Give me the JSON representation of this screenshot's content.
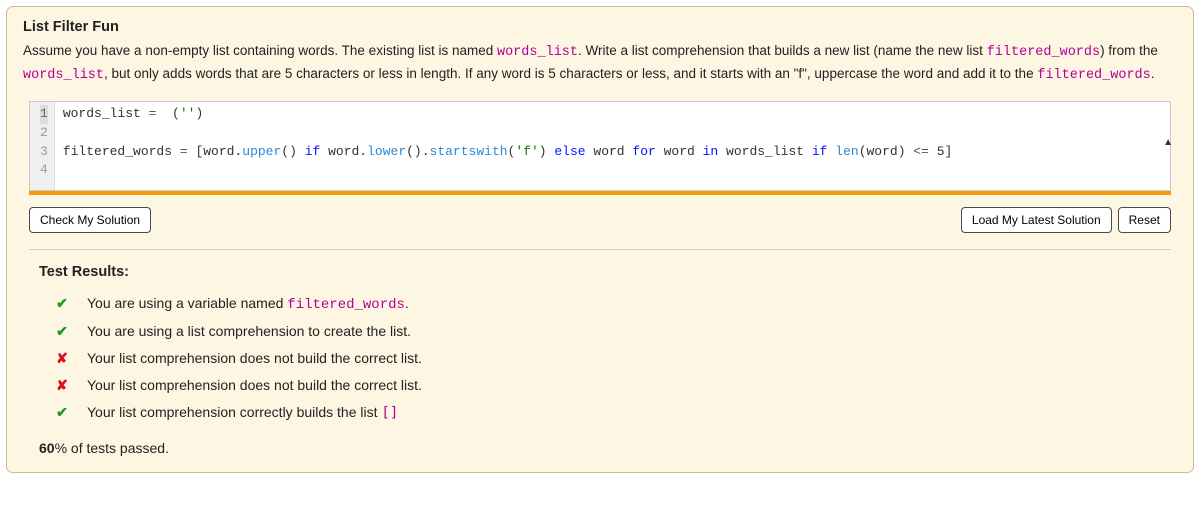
{
  "title": "List Filter Fun",
  "prompt": {
    "p1a": "Assume you have a non-empty list containing words. The existing list is named ",
    "words_list": "words_list",
    "p1b": ". Write a list comprehension that builds a new list (name the new list ",
    "filtered_words": "filtered_words",
    "p1c": ") from the ",
    "words_list2": "words_list",
    "p1d": ", but only adds words that are 5 characters or less in length. If any word is 5 characters or less, and it starts with an \"f\", uppercase the word and add it to the ",
    "filtered_words2": "filtered_words",
    "p1e": "."
  },
  "editor": {
    "lines": [
      "1",
      "2",
      "3",
      "4"
    ],
    "l1": {
      "a": "words_list ",
      "op": "=",
      "b": "  (",
      "str": "''",
      "c": ")"
    },
    "l3": {
      "a": "filtered_words ",
      "eq": "=",
      "b": " [word.",
      "upper": "upper",
      "c": "() ",
      "if1": "if",
      "d": " word.",
      "lower": "lower",
      "e": "().",
      "startswith": "startswith",
      "f": "(",
      "str": "'f'",
      "g": ") ",
      "else": "else",
      "h": " word ",
      "for": "for",
      "i": " word ",
      "in": "in",
      "j": " words_list ",
      "if2": "if",
      "k": " ",
      "len": "len",
      "l": "(word) ",
      "lte": "<=",
      "m": " ",
      "five": "5",
      "n": "]"
    }
  },
  "buttons": {
    "check": "Check My Solution",
    "load": "Load My Latest Solution",
    "reset": "Reset"
  },
  "results": {
    "title": "Test Results:",
    "items": [
      {
        "pass": true,
        "pre": "You are using a variable named ",
        "code": "filtered_words",
        "post": "."
      },
      {
        "pass": true,
        "pre": "You are using a list comprehension to create the list.",
        "code": "",
        "post": ""
      },
      {
        "pass": false,
        "pre": "Your list comprehension does not build the correct list.",
        "code": "",
        "post": ""
      },
      {
        "pass": false,
        "pre": "Your list comprehension does not build the correct list.",
        "code": "",
        "post": ""
      },
      {
        "pass": true,
        "pre": "Your list comprehension correctly builds the list ",
        "code": "[]",
        "post": ""
      }
    ],
    "pass_pct": "60",
    "pass_suffix": "% of tests passed."
  }
}
